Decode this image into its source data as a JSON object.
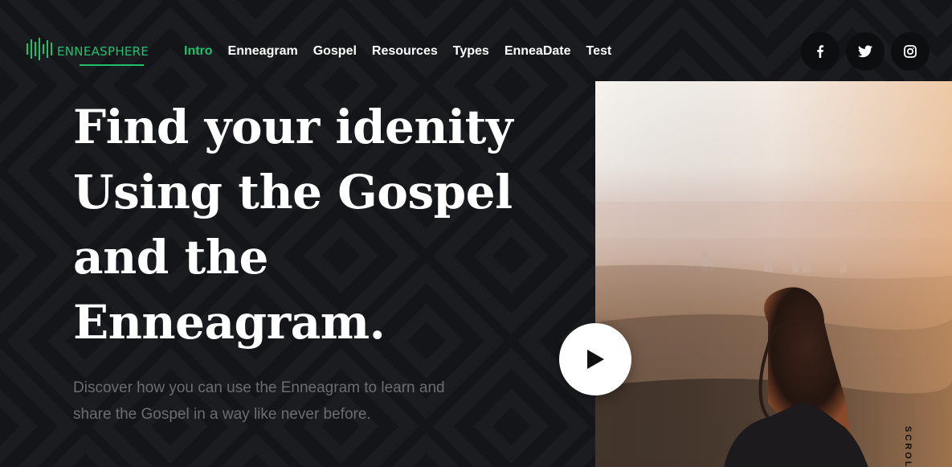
{
  "brand": {
    "name": "ENNEASPHERE",
    "accent_color": "#1fc16b"
  },
  "nav": {
    "items": [
      {
        "label": "Intro",
        "active": true
      },
      {
        "label": "Enneagram",
        "active": false
      },
      {
        "label": "Gospel",
        "active": false
      },
      {
        "label": "Resources",
        "active": false
      },
      {
        "label": "Types",
        "active": false
      },
      {
        "label": "EnneaDate",
        "active": false
      },
      {
        "label": "Test",
        "active": false
      }
    ]
  },
  "social": {
    "icons": [
      "facebook-icon",
      "twitter-icon",
      "instagram-icon"
    ]
  },
  "hero": {
    "title_lines": [
      "Find your idenity",
      "Using the Gospel",
      "and the",
      "Enneagram."
    ],
    "subtitle_lines": [
      "Discover how you can use the Enneagram to learn and",
      "share the Gospel in a way like never before."
    ]
  },
  "media": {
    "play_icon": "play-icon",
    "scroll_label": "SCROLL"
  }
}
